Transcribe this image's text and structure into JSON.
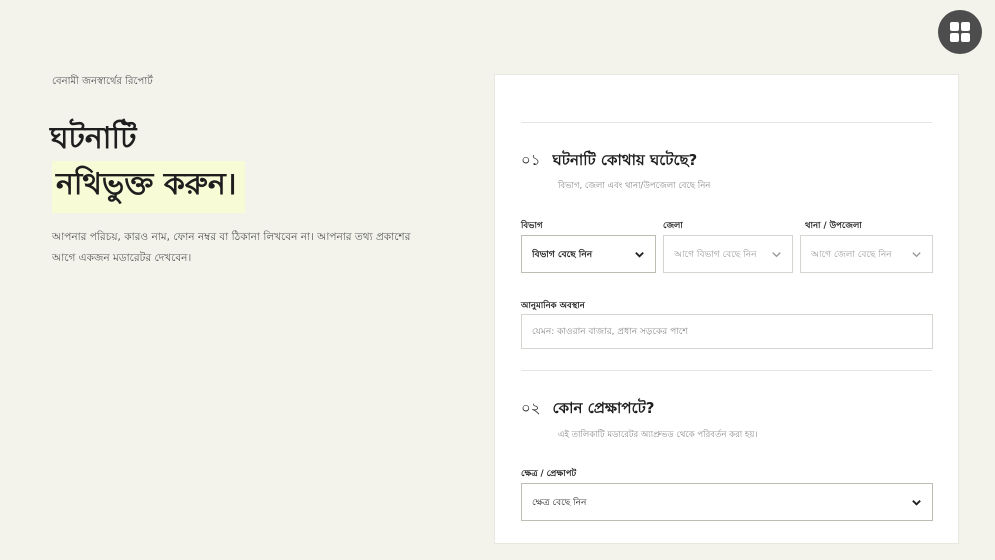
{
  "menu_icon": "grid-icon",
  "left": {
    "eyebrow": "বেনামী জনস্বার্থের রিপোর্ট",
    "title_line1": "ঘটনাটি",
    "title_line2": "নথিভুক্ত করুন।",
    "description": "আপনার পরিচয়, কারও নাম, ফোন নম্বর বা ঠিকানা লিখবেন না। আপনার তথ্য প্রকাশের আগে একজন মডারেটর দেখবেন।"
  },
  "section1": {
    "number": "০১",
    "title": "ঘটনাটি কোথায় ঘটেছে?",
    "subtitle": "বিভাগ, জেলা এবং থানা/উপজেলা বেছে নিন",
    "division_label": "বিভাগ",
    "division_value": "বিভাগ বেছে নিন",
    "district_label": "জেলা",
    "district_value": "আগে বিভাগ বেছে নিন",
    "upazila_label": "থানা / উপজেলা",
    "upazila_value": "আগে জেলা বেছে নিন",
    "location_label": "আনুমানিক অবস্থান",
    "location_placeholder": "যেমন: কাওরান বাজার, প্রধান সড়কের পাশে"
  },
  "section2": {
    "number": "০২",
    "title": "কোন প্রেক্ষাপটে?",
    "subtitle": "এই তালিকাটি মডারেটর অ্যাপ্রুভড থেকে পরিবর্তন করা হয়।",
    "context_label": "ক্ষেত্র / প্রেক্ষাপট",
    "context_value": "ক্ষেত্র বেছে নিন"
  }
}
